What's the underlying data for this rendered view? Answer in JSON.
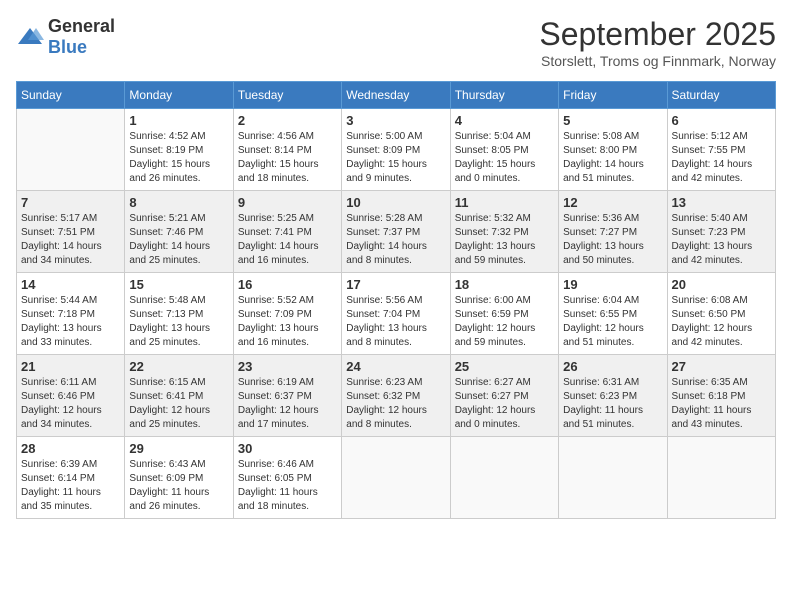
{
  "logo": {
    "general": "General",
    "blue": "Blue"
  },
  "title": "September 2025",
  "subtitle": "Storslett, Troms og Finnmark, Norway",
  "weekdays": [
    "Sunday",
    "Monday",
    "Tuesday",
    "Wednesday",
    "Thursday",
    "Friday",
    "Saturday"
  ],
  "weeks": [
    [
      {
        "day": "",
        "info": ""
      },
      {
        "day": "1",
        "info": "Sunrise: 4:52 AM\nSunset: 8:19 PM\nDaylight: 15 hours\nand 26 minutes."
      },
      {
        "day": "2",
        "info": "Sunrise: 4:56 AM\nSunset: 8:14 PM\nDaylight: 15 hours\nand 18 minutes."
      },
      {
        "day": "3",
        "info": "Sunrise: 5:00 AM\nSunset: 8:09 PM\nDaylight: 15 hours\nand 9 minutes."
      },
      {
        "day": "4",
        "info": "Sunrise: 5:04 AM\nSunset: 8:05 PM\nDaylight: 15 hours\nand 0 minutes."
      },
      {
        "day": "5",
        "info": "Sunrise: 5:08 AM\nSunset: 8:00 PM\nDaylight: 14 hours\nand 51 minutes."
      },
      {
        "day": "6",
        "info": "Sunrise: 5:12 AM\nSunset: 7:55 PM\nDaylight: 14 hours\nand 42 minutes."
      }
    ],
    [
      {
        "day": "7",
        "info": "Sunrise: 5:17 AM\nSunset: 7:51 PM\nDaylight: 14 hours\nand 34 minutes."
      },
      {
        "day": "8",
        "info": "Sunrise: 5:21 AM\nSunset: 7:46 PM\nDaylight: 14 hours\nand 25 minutes."
      },
      {
        "day": "9",
        "info": "Sunrise: 5:25 AM\nSunset: 7:41 PM\nDaylight: 14 hours\nand 16 minutes."
      },
      {
        "day": "10",
        "info": "Sunrise: 5:28 AM\nSunset: 7:37 PM\nDaylight: 14 hours\nand 8 minutes."
      },
      {
        "day": "11",
        "info": "Sunrise: 5:32 AM\nSunset: 7:32 PM\nDaylight: 13 hours\nand 59 minutes."
      },
      {
        "day": "12",
        "info": "Sunrise: 5:36 AM\nSunset: 7:27 PM\nDaylight: 13 hours\nand 50 minutes."
      },
      {
        "day": "13",
        "info": "Sunrise: 5:40 AM\nSunset: 7:23 PM\nDaylight: 13 hours\nand 42 minutes."
      }
    ],
    [
      {
        "day": "14",
        "info": "Sunrise: 5:44 AM\nSunset: 7:18 PM\nDaylight: 13 hours\nand 33 minutes."
      },
      {
        "day": "15",
        "info": "Sunrise: 5:48 AM\nSunset: 7:13 PM\nDaylight: 13 hours\nand 25 minutes."
      },
      {
        "day": "16",
        "info": "Sunrise: 5:52 AM\nSunset: 7:09 PM\nDaylight: 13 hours\nand 16 minutes."
      },
      {
        "day": "17",
        "info": "Sunrise: 5:56 AM\nSunset: 7:04 PM\nDaylight: 13 hours\nand 8 minutes."
      },
      {
        "day": "18",
        "info": "Sunrise: 6:00 AM\nSunset: 6:59 PM\nDaylight: 12 hours\nand 59 minutes."
      },
      {
        "day": "19",
        "info": "Sunrise: 6:04 AM\nSunset: 6:55 PM\nDaylight: 12 hours\nand 51 minutes."
      },
      {
        "day": "20",
        "info": "Sunrise: 6:08 AM\nSunset: 6:50 PM\nDaylight: 12 hours\nand 42 minutes."
      }
    ],
    [
      {
        "day": "21",
        "info": "Sunrise: 6:11 AM\nSunset: 6:46 PM\nDaylight: 12 hours\nand 34 minutes."
      },
      {
        "day": "22",
        "info": "Sunrise: 6:15 AM\nSunset: 6:41 PM\nDaylight: 12 hours\nand 25 minutes."
      },
      {
        "day": "23",
        "info": "Sunrise: 6:19 AM\nSunset: 6:37 PM\nDaylight: 12 hours\nand 17 minutes."
      },
      {
        "day": "24",
        "info": "Sunrise: 6:23 AM\nSunset: 6:32 PM\nDaylight: 12 hours\nand 8 minutes."
      },
      {
        "day": "25",
        "info": "Sunrise: 6:27 AM\nSunset: 6:27 PM\nDaylight: 12 hours\nand 0 minutes."
      },
      {
        "day": "26",
        "info": "Sunrise: 6:31 AM\nSunset: 6:23 PM\nDaylight: 11 hours\nand 51 minutes."
      },
      {
        "day": "27",
        "info": "Sunrise: 6:35 AM\nSunset: 6:18 PM\nDaylight: 11 hours\nand 43 minutes."
      }
    ],
    [
      {
        "day": "28",
        "info": "Sunrise: 6:39 AM\nSunset: 6:14 PM\nDaylight: 11 hours\nand 35 minutes."
      },
      {
        "day": "29",
        "info": "Sunrise: 6:43 AM\nSunset: 6:09 PM\nDaylight: 11 hours\nand 26 minutes."
      },
      {
        "day": "30",
        "info": "Sunrise: 6:46 AM\nSunset: 6:05 PM\nDaylight: 11 hours\nand 18 minutes."
      },
      {
        "day": "",
        "info": ""
      },
      {
        "day": "",
        "info": ""
      },
      {
        "day": "",
        "info": ""
      },
      {
        "day": "",
        "info": ""
      }
    ]
  ]
}
